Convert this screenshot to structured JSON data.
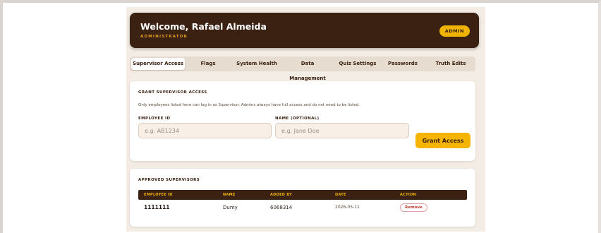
{
  "header": {
    "title": "Welcome, Rafael Almeida",
    "role_label": "ADMINISTRATOR",
    "badge": "ADMIN"
  },
  "tabs": [
    {
      "label": "Supervisor Access",
      "active": true
    },
    {
      "label": "Flags",
      "active": false
    },
    {
      "label": "System Health",
      "active": false
    },
    {
      "label": "Data Management",
      "active": false
    },
    {
      "label": "Quiz Settings",
      "active": false
    },
    {
      "label": "Passwords",
      "active": false
    },
    {
      "label": "Truth Edits",
      "active": false
    }
  ],
  "grant": {
    "title": "GRANT SUPERVISOR ACCESS",
    "description": "Only employees listed here can log in as Supervisor. Admins always have full access and do not need to be listed.",
    "employee_id_label": "EMPLOYEE ID",
    "employee_id_placeholder": "e.g. AB1234",
    "employee_id_value": "",
    "name_label": "NAME (OPTIONAL)",
    "name_placeholder": "e.g. Jane Doe",
    "name_value": "",
    "button": "Grant Access"
  },
  "approved": {
    "title": "APPROVED SUPERVISORS",
    "columns": [
      "EMPLOYEE ID",
      "NAME",
      "ADDED BY",
      "DATE",
      "ACTION"
    ],
    "rows": [
      {
        "employee_id": "1111111",
        "name": "Dumy",
        "added_by": "6068314",
        "date": "2026-05-11",
        "action": "Remove"
      }
    ]
  },
  "colors": {
    "header_bg": "#3a2112",
    "accent": "#f5b400",
    "page_bg": "#f3ede5",
    "danger": "#c0392b"
  }
}
